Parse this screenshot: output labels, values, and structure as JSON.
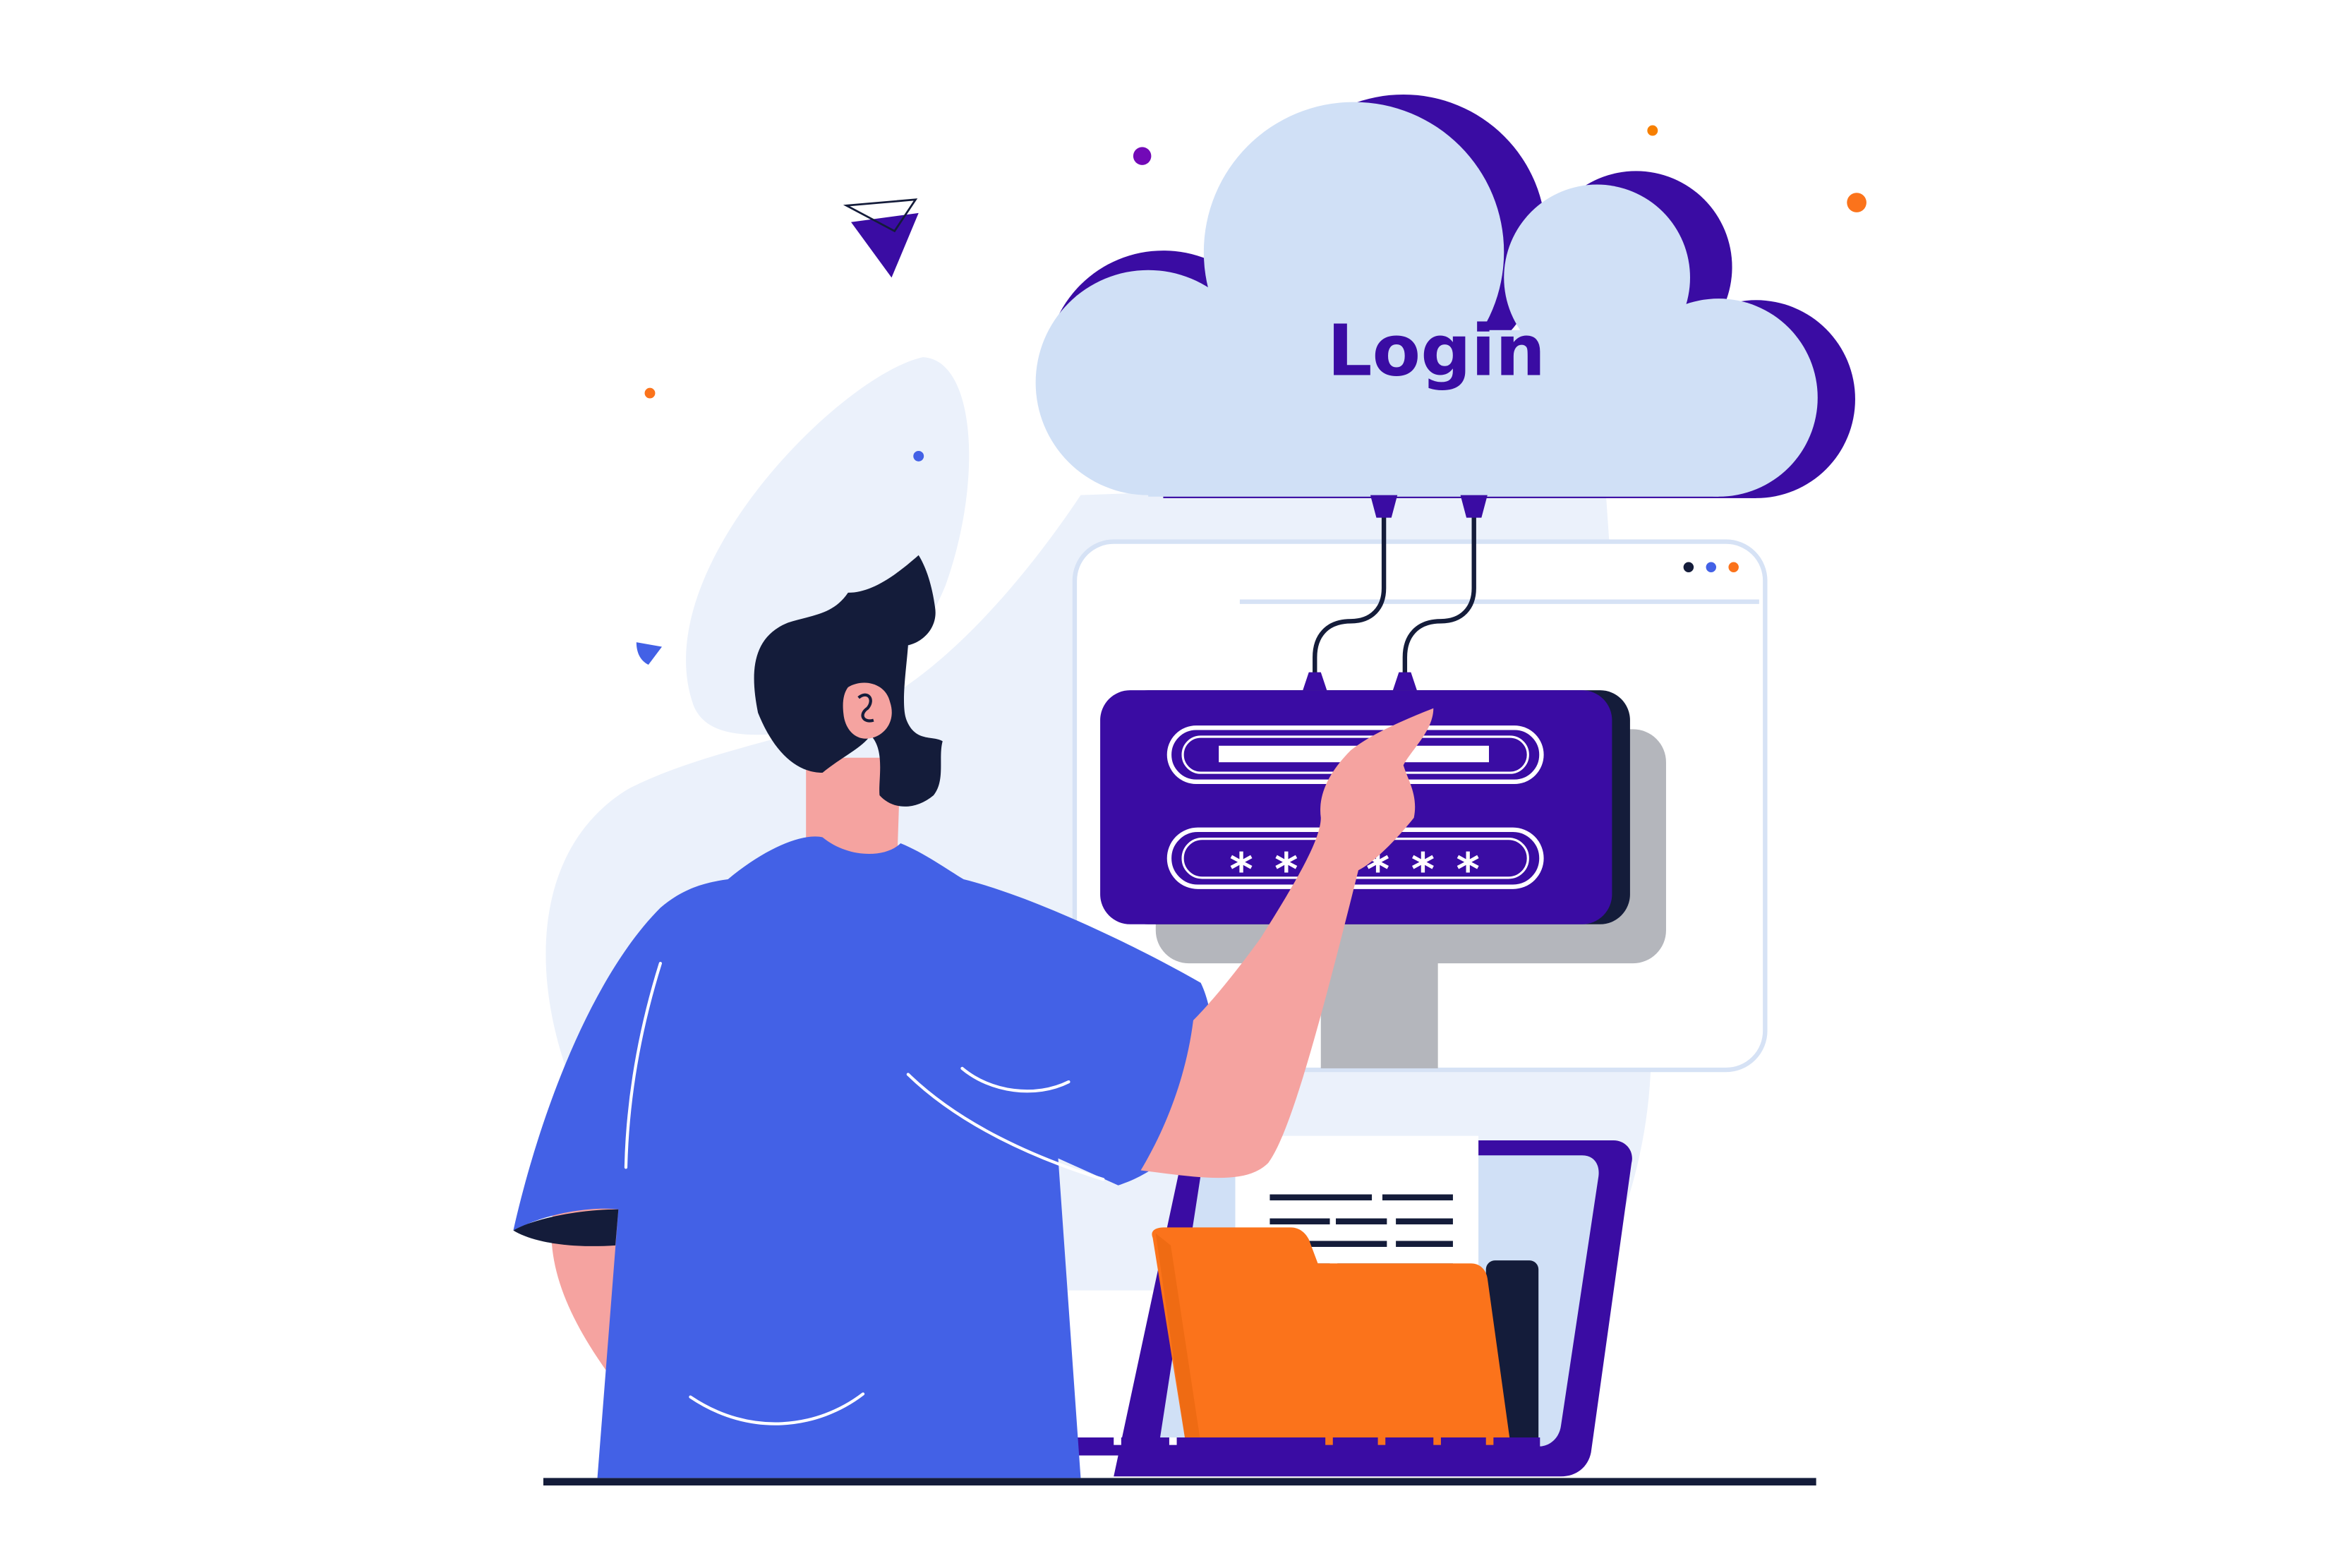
{
  "cloud": {
    "label": "Login"
  },
  "login_form": {
    "password_mask": [
      "*",
      "*",
      "*",
      "*",
      "*",
      "*"
    ]
  },
  "browser_window": {
    "window_dots": [
      "dark",
      "blue",
      "orange"
    ]
  },
  "palette": {
    "indigo": "#3a0ca3",
    "cloud_fill": "#d0e0f6",
    "shirt": "#4361e6",
    "skin": "#f5a3a0",
    "hair": "#141c3a",
    "folder": "#fb731b",
    "window_outline": "#d6e2f5",
    "background_blob": "#ebf1fb",
    "shadow_grey": "#b4b6bc"
  }
}
